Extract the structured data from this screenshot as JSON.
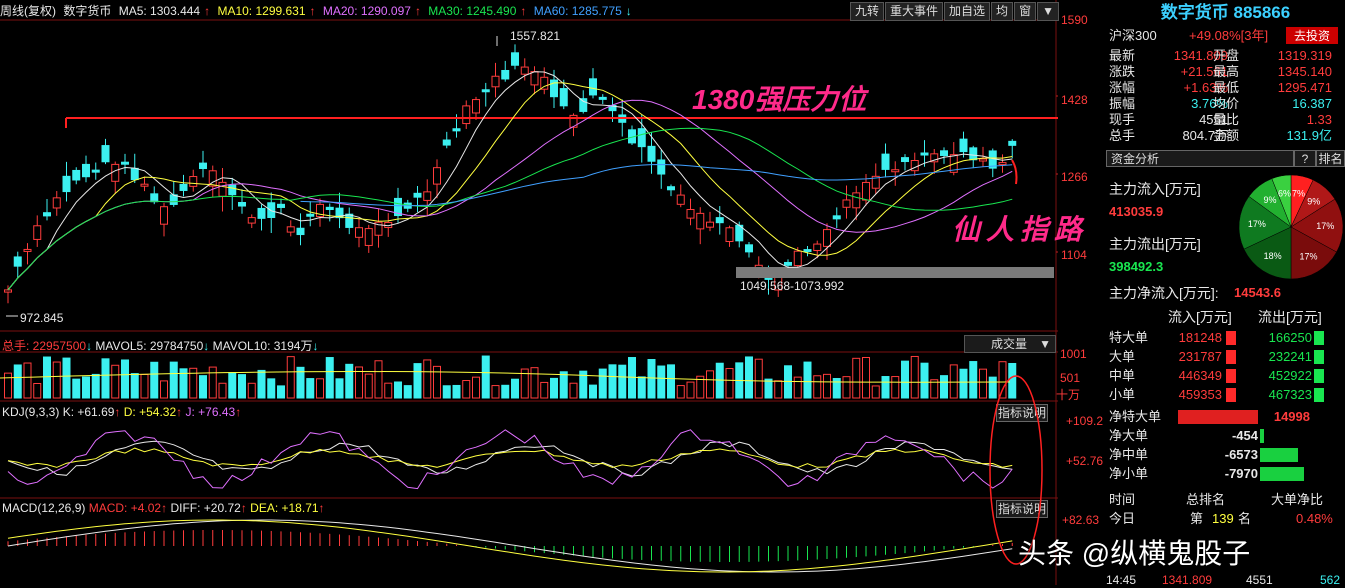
{
  "topbar": {
    "title": "周线(复权)",
    "name": "数字货币",
    "ma5": "MA5: 1303.444",
    "ma10": "MA10: 1299.631",
    "ma20": "MA20: 1290.097",
    "ma30": "MA30: 1245.490",
    "ma60": "MA60: 1285.775",
    "arrow_up": "↑",
    "arrow_down": "↓"
  },
  "buttons": [
    "九转",
    "重大事件",
    "加自选",
    "均",
    "窗",
    "▼"
  ],
  "price_axis": [
    "1590",
    "1428",
    "1266",
    "1104"
  ],
  "annotations": {
    "high": "1557.821",
    "low": "972.845",
    "range": "1049.568-1073.992",
    "resist": "1380强压力位",
    "xianren": "仙人指路"
  },
  "volume": {
    "total": "总手: 22957500",
    "mavol5": "MAVOL5: 29784750",
    "mavol10": "MAVOL10: 3194万",
    "select": "成交量",
    "axis": [
      "1001",
      "501",
      "十万"
    ]
  },
  "kdj": {
    "label": "KDJ(9,3,3)",
    "k": "K: +61.69",
    "d": "D: +54.32",
    "j": "J: +76.43",
    "axis": [
      "+109.2",
      "+52.76"
    ],
    "explain": "指标说明"
  },
  "macd": {
    "label": "MACD(12,26,9)",
    "macd": "MACD: +4.02",
    "diff": "DIFF: +20.72",
    "dea": "DEA: +18.71",
    "axis": [
      "+82.63"
    ],
    "explain": "指标说明"
  },
  "side": {
    "title": "数字货币 885866",
    "hs300": "沪深300",
    "hs300_val": "+49.08%[3年]",
    "invest": "去投资",
    "quotes": [
      [
        "最新",
        "1341.809",
        "开盘",
        "1319.319"
      ],
      [
        "涨跌",
        "+21.561",
        "最高",
        "1345.140"
      ],
      [
        "涨幅",
        "+1.63%",
        "最低",
        "1295.471"
      ],
      [
        "振幅",
        "3.76%",
        "均价",
        "16.387"
      ],
      [
        "现手",
        "4551",
        "量比",
        "1.33"
      ],
      [
        "总手",
        "804.7万",
        "金额",
        "131.9亿"
      ]
    ],
    "fund": "资金分析",
    "help": "?",
    "rank": "排名",
    "inflow_label": "主力流入[万元]",
    "inflow": "413035.9",
    "outflow_label": "主力流出[万元]",
    "outflow": "398492.3",
    "net_label": "主力净流入[万元]:",
    "net": "14543.6",
    "pie": [
      "7%",
      "9%",
      "17%",
      "17%",
      "18%",
      "17%",
      "9%",
      "6%"
    ],
    "flow_head": [
      "流入[万元]",
      "流出[万元]"
    ],
    "flows": [
      [
        "特大单",
        "181248",
        "166250"
      ],
      [
        "大单",
        "231787",
        "232241"
      ],
      [
        "中单",
        "446349",
        "452922"
      ],
      [
        "小单",
        "459353",
        "467323"
      ]
    ],
    "nets": [
      [
        "净特大单",
        "14998"
      ],
      [
        "净大单",
        "-454"
      ],
      [
        "净中单",
        "-6573"
      ],
      [
        "净小单",
        "-7970"
      ]
    ],
    "rank_head": [
      "时间",
      "总排名",
      "大单净比"
    ],
    "rank_row": [
      "今日",
      "第",
      "139",
      "名",
      "0.48%"
    ],
    "watermark": "头条 @纵横鬼股子",
    "bottom": [
      "14:45",
      "1341.809",
      "4551",
      "562"
    ]
  }
}
